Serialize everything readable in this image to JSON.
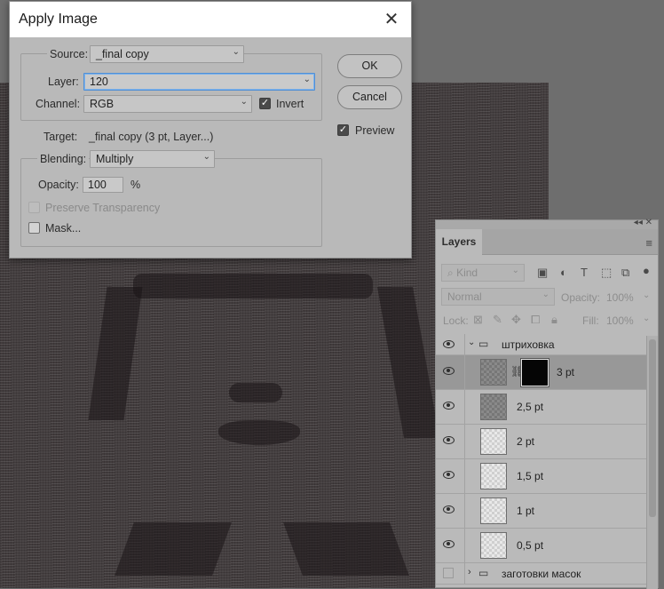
{
  "dialog": {
    "title": "Apply Image",
    "source_label": "Source:",
    "source_value": "_final copy",
    "layer_label": "Layer:",
    "layer_value": "120",
    "channel_label": "Channel:",
    "channel_value": "RGB",
    "invert_label": "Invert",
    "invert_checked": true,
    "target_label": "Target:",
    "target_value": "_final copy (3 pt, Layer...)",
    "blending_label": "Blending:",
    "blending_value": "Multiply",
    "opacity_label": "Opacity:",
    "opacity_value": "100",
    "opacity_unit": "%",
    "preserve_label": "Preserve Transparency",
    "mask_label": "Mask...",
    "ok_label": "OK",
    "cancel_label": "Cancel",
    "preview_label": "Preview",
    "preview_checked": true
  },
  "layers_panel": {
    "tab": "Layers",
    "kind_placeholder": "Kind",
    "blend_mode": "Normal",
    "opacity_label": "Opacity:",
    "opacity_value": "100%",
    "lock_label": "Lock:",
    "fill_label": "Fill:",
    "fill_value": "100%",
    "group_name": "штриховка",
    "layers": [
      {
        "name": "3 pt",
        "selected": true,
        "has_mask": true
      },
      {
        "name": "2,5 pt"
      },
      {
        "name": "2 pt"
      },
      {
        "name": "1,5 pt"
      },
      {
        "name": "1 pt"
      },
      {
        "name": "0,5 pt"
      }
    ],
    "group2_name": "заготовки масок"
  },
  "icons": {
    "close": "close-icon",
    "eye": "eye-icon",
    "folder": "folder-icon",
    "chain": "chain-link-icon",
    "menu": "panel-menu-icon"
  },
  "colors": {
    "dialog_bg": "#b9b9b9",
    "focus": "#4f8fd6",
    "canvas": "#413b3c"
  }
}
